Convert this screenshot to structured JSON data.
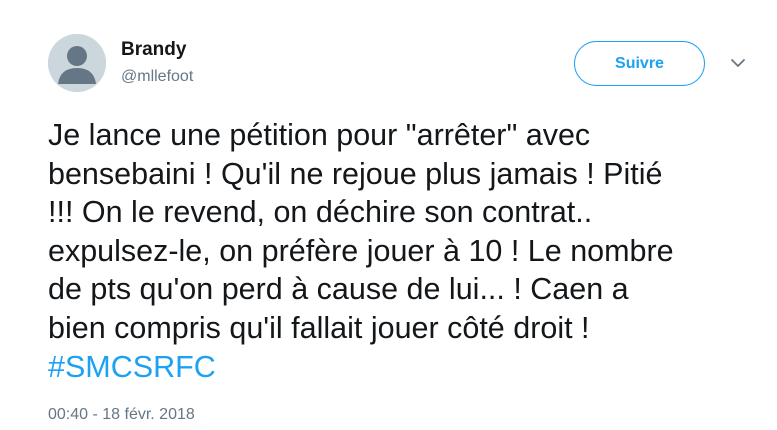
{
  "author": {
    "name": "Brandy",
    "handle": "@mllefoot",
    "avatar_icon": "default-user-avatar"
  },
  "follow_button": {
    "label": "Suivre"
  },
  "menu_icon": "chevron-down-icon",
  "tweet": {
    "lines": [
      "Je lance une pétition pour \"arrêter\" avec",
      "bensebaini ! Qu'il ne rejoue plus jamais ! Pitié",
      "!!! On le revend, on déchire son contrat..",
      "expulsez-le, on préfère jouer à 10 ! Le nombre",
      "de pts qu'on perd à cause de lui... ! Caen a",
      "bien compris qu'il fallait jouer côté droit !"
    ],
    "hashtag": "#SMCSRFC",
    "timestamp": "00:40 - 18 févr. 2018"
  },
  "colors": {
    "accent": "#1da1f2",
    "text": "#14171a",
    "muted": "#657786",
    "avatar_bg": "#ccd6dd"
  }
}
